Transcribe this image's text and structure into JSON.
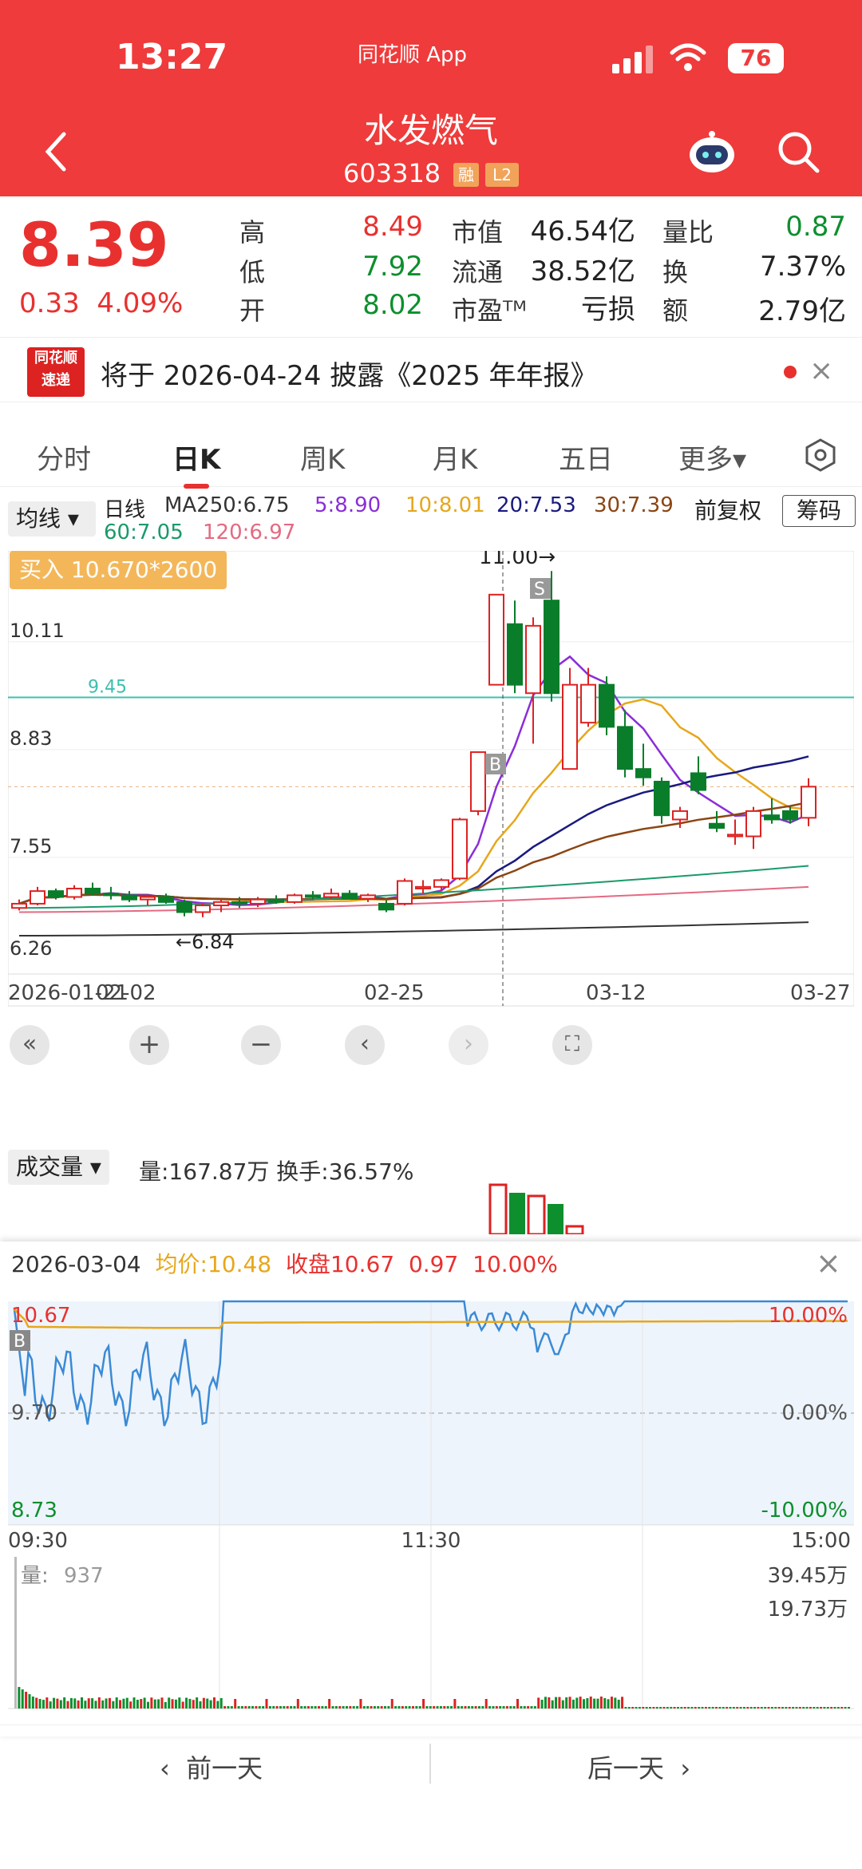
{
  "status_bar": {
    "time": "13:27",
    "carrier": "同花顺 App",
    "battery": "76"
  },
  "header": {
    "title": "水发燃气",
    "code": "603318",
    "tag_rong": "融",
    "tag_l2": "L2"
  },
  "quote": {
    "price": "8.39",
    "change": "0.33",
    "change_pct": "4.09%",
    "high_label": "高",
    "high": "8.49",
    "low_label": "低",
    "low": "7.92",
    "open_label": "开",
    "open": "8.02",
    "mcap_label": "市值",
    "mcap": "46.54亿",
    "float_label": "流通",
    "float": "38.52亿",
    "pe_label": "市盈ᵀᴹ",
    "pe": "亏损",
    "vr_label": "量比",
    "vr": "0.87",
    "turnover_label": "换",
    "turnover": "7.37%",
    "amount_label": "额",
    "amount": "2.79亿"
  },
  "notice": {
    "logo_top": "同花顺",
    "logo_bottom": "速递",
    "text": "将于 2026-04-24 披露《2025 年年报》"
  },
  "tabs": [
    "分时",
    "日K",
    "周K",
    "月K",
    "五日",
    "更多▾"
  ],
  "ma_row": {
    "indicator": "均线 ▾",
    "period": "日线",
    "ma250": "MA250:6.75",
    "ma5": "5:8.90",
    "ma10": "10:8.01",
    "ma20": "20:7.53",
    "ma30": "30:7.39",
    "ma60": "60:7.05",
    "ma120": "120:6.97",
    "adjust": "前复权",
    "chip": "筹码"
  },
  "kchart_labels": {
    "buy_badge": "买入 10.670*2600",
    "peak": "11.00→",
    "low_marker": "←6.84",
    "s_marker": "S",
    "b_marker": "B",
    "line_945": "9.45",
    "y_labels": [
      "10.11",
      "8.83",
      "7.55",
      "6.26"
    ],
    "x_labels": [
      "2026-01-21",
      "02-02",
      "02-25",
      "03-12",
      "03-27"
    ]
  },
  "volume": {
    "indicator": "成交量 ▾",
    "text": "量:167.87万  换手:36.57%"
  },
  "popup": {
    "date": "2026-03-04",
    "avg_label": "均价:",
    "avg": "10.48",
    "close_label": "收盘",
    "close": "10.67",
    "chg": "0.97",
    "chg_pct": "10.00%",
    "left_top": "10.67",
    "left_mid": "9.70",
    "left_bot": "8.73",
    "right_top": "10.00%",
    "right_mid": "0.00%",
    "right_bot": "-10.00%",
    "time_start": "09:30",
    "time_mid": "11:30",
    "time_end": "15:00",
    "vol_label": "量:",
    "vol_value": "937",
    "vol_max": "39.45万",
    "vol_mid": "19.73万",
    "b_marker": "B"
  },
  "footer": {
    "prev": "前一天",
    "next": "后一天"
  },
  "chart_data": {
    "type": "candlestick",
    "ylim": [
      6.26,
      11.0
    ],
    "y_ticks": [
      10.11,
      8.83,
      7.55,
      6.26
    ],
    "x_ticks": [
      "2026-01-21",
      "02-02",
      "02-25",
      "03-12",
      "03-27"
    ],
    "candles": [
      [
        6.95,
        7.05,
        6.92,
        7.0
      ],
      [
        7.0,
        7.2,
        6.98,
        7.15
      ],
      [
        7.15,
        7.18,
        7.05,
        7.08
      ],
      [
        7.08,
        7.22,
        7.05,
        7.18
      ],
      [
        7.18,
        7.25,
        7.1,
        7.12
      ],
      [
        7.12,
        7.2,
        7.05,
        7.1
      ],
      [
        7.1,
        7.15,
        7.02,
        7.05
      ],
      [
        7.05,
        7.1,
        6.98,
        7.08
      ],
      [
        7.08,
        7.12,
        7.0,
        7.02
      ],
      [
        7.02,
        7.05,
        6.85,
        6.9
      ],
      [
        6.9,
        7.0,
        6.84,
        6.98
      ],
      [
        6.98,
        7.05,
        6.9,
        7.02
      ],
      [
        7.02,
        7.08,
        6.95,
        7.0
      ],
      [
        7.0,
        7.08,
        6.96,
        7.05
      ],
      [
        7.05,
        7.1,
        7.0,
        7.02
      ],
      [
        7.02,
        7.12,
        7.0,
        7.1
      ],
      [
        7.1,
        7.15,
        7.05,
        7.08
      ],
      [
        7.08,
        7.18,
        7.05,
        7.12
      ],
      [
        7.12,
        7.16,
        7.05,
        7.06
      ],
      [
        7.06,
        7.12,
        7.02,
        7.1
      ],
      [
        7.0,
        7.04,
        6.9,
        6.93
      ],
      [
        7.0,
        7.3,
        6.98,
        7.27
      ],
      [
        7.18,
        7.28,
        7.12,
        7.2
      ],
      [
        7.2,
        7.3,
        7.15,
        7.28
      ],
      [
        7.3,
        8.02,
        7.28,
        8.0
      ],
      [
        8.1,
        8.8,
        8.05,
        8.8
      ],
      [
        9.6,
        10.67,
        9.6,
        10.67
      ],
      [
        10.32,
        10.6,
        9.5,
        9.6
      ],
      [
        9.5,
        10.4,
        8.9,
        10.3
      ],
      [
        10.6,
        10.95,
        9.4,
        9.5
      ],
      [
        8.6,
        9.8,
        8.6,
        9.6
      ],
      [
        9.15,
        9.8,
        9.1,
        9.6
      ],
      [
        9.6,
        9.7,
        9.0,
        9.1
      ],
      [
        9.1,
        9.3,
        8.5,
        8.6
      ],
      [
        8.6,
        8.9,
        8.4,
        8.5
      ],
      [
        8.45,
        8.5,
        7.95,
        8.05
      ],
      [
        8.0,
        8.15,
        7.9,
        8.1
      ],
      [
        8.55,
        8.75,
        8.3,
        8.35
      ],
      [
        7.95,
        8.1,
        7.85,
        7.9
      ],
      [
        7.8,
        8.0,
        7.7,
        7.82
      ],
      [
        7.8,
        8.15,
        7.65,
        8.1
      ],
      [
        8.05,
        8.25,
        7.95,
        8.0
      ],
      [
        8.1,
        8.15,
        7.95,
        8.0
      ],
      [
        8.02,
        8.49,
        7.92,
        8.39
      ]
    ]
  }
}
